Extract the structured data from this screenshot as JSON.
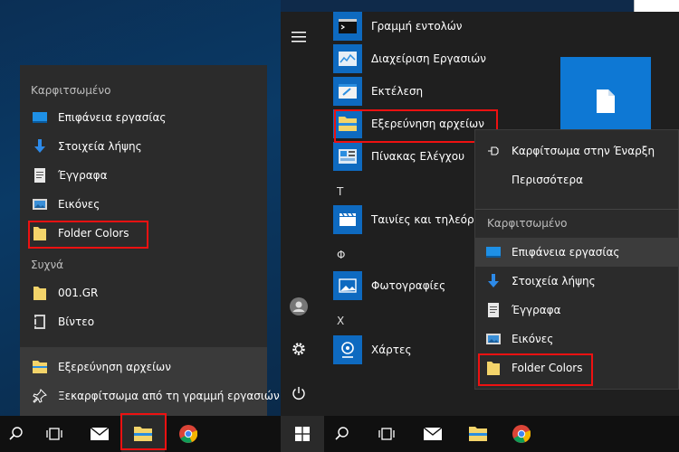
{
  "jumplist": {
    "pinned_header": "Καρφιτσωμένο",
    "pinned": [
      {
        "label": "Επιφάνεια εργασίας",
        "icon": "desktop-icon"
      },
      {
        "label": "Στοιχεία λήψης",
        "icon": "download-icon"
      },
      {
        "label": "Έγγραφα",
        "icon": "document-icon"
      },
      {
        "label": "Εικόνες",
        "icon": "pictures-icon"
      },
      {
        "label": "Folder Colors",
        "icon": "folder-icon"
      }
    ],
    "frequent_header": "Συχνά",
    "frequent": [
      {
        "label": "001.GR",
        "icon": "folder-icon"
      },
      {
        "label": "Βίντεο",
        "icon": "video-icon"
      }
    ],
    "actions": [
      {
        "label": "Εξερεύνηση αρχείων",
        "icon": "file-explorer-icon"
      },
      {
        "label": "Ξεκαρφίτσωμα από τη γραμμή εργασιών",
        "icon": "unpin-icon"
      }
    ]
  },
  "startmenu": {
    "apps": [
      {
        "label": "Γραμμή εντολών",
        "icon": "cmd-icon"
      },
      {
        "label": "Διαχείριση Εργασιών",
        "icon": "task-manager-icon"
      },
      {
        "label": "Εκτέλεση",
        "icon": "run-icon"
      },
      {
        "label": "Εξερεύνηση αρχείων",
        "icon": "file-explorer-icon"
      },
      {
        "label": "Πίνακας Ελέγχου",
        "icon": "control-panel-icon"
      }
    ],
    "letter_t": "Τ",
    "app_t": "Ταινίες και τηλεόραση",
    "letter_f": "Φ",
    "app_f": "Φωτογραφίες",
    "letter_x": "Χ",
    "app_x": "Χάρτες"
  },
  "context_menu": {
    "items": [
      {
        "label": "Καρφίτσωμα στην Έναρξη",
        "icon": "pin-icon"
      },
      {
        "label": "Περισσότερα",
        "icon": ""
      }
    ],
    "pinned_header": "Καρφιτσωμένο",
    "pinned": [
      {
        "label": "Επιφάνεια εργασίας",
        "icon": "desktop-icon"
      },
      {
        "label": "Στοιχεία λήψης",
        "icon": "download-icon"
      },
      {
        "label": "Έγγραφα",
        "icon": "document-icon"
      },
      {
        "label": "Εικόνες",
        "icon": "pictures-icon"
      },
      {
        "label": "Folder Colors",
        "icon": "folder-icon"
      }
    ]
  },
  "colors": {
    "accent": "#0e6ac0",
    "highlight": "#e11111",
    "folder": "#f3d46a"
  }
}
